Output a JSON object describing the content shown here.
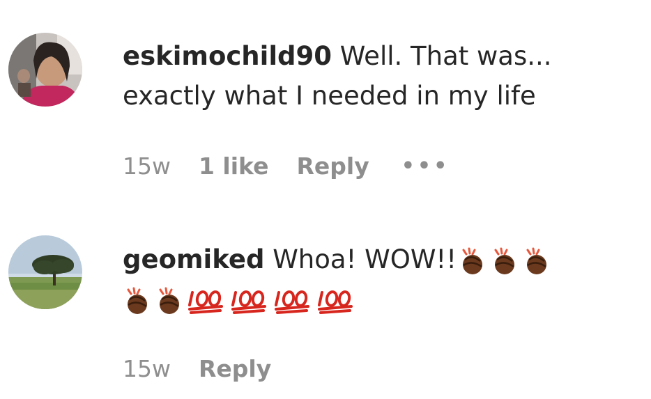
{
  "comments": [
    {
      "username": "eskimochild90",
      "text_line1": "Well. That was...",
      "text_line2": "exactly what I needed in my life",
      "time": "15w",
      "likes": "1 like",
      "reply": "Reply",
      "more": "•••"
    },
    {
      "username": "geomiked",
      "text": "Whoa! WOW!!",
      "time": "15w",
      "reply": "Reply",
      "emojis_line1": [
        "clap-icon",
        "clap-icon",
        "clap-icon"
      ],
      "emojis_line2": [
        "clap-icon",
        "clap-icon",
        "hundred-icon",
        "hundred-icon",
        "hundred-icon",
        "hundred-icon"
      ]
    }
  ]
}
